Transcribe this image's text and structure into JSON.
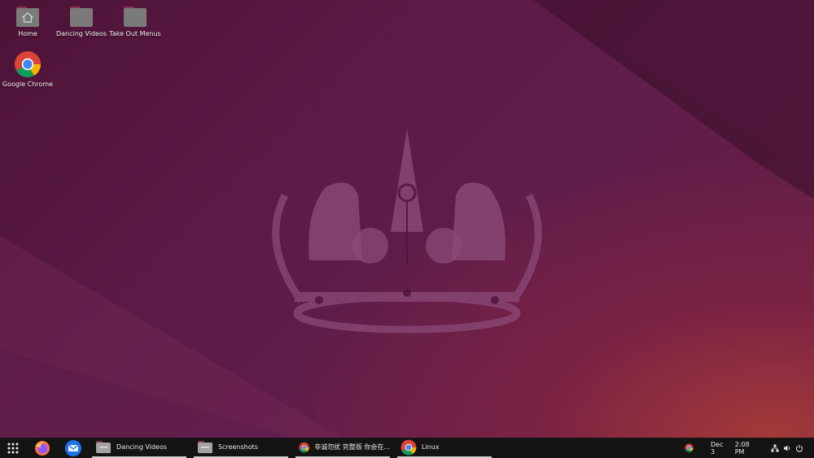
{
  "desktop_icons": [
    {
      "id": "home",
      "label": "Home",
      "icon": "home-folder-icon"
    },
    {
      "id": "dancing",
      "label": "Dancing Videos",
      "icon": "folder-icon"
    },
    {
      "id": "takeout",
      "label": "Take Out Menus",
      "icon": "folder-icon"
    },
    {
      "id": "chrome",
      "label": "Google Chrome",
      "icon": "chrome-icon"
    }
  ],
  "taskbar": {
    "launcher_icon": "app-grid-icon",
    "pinned": [
      {
        "name": "Firefox",
        "icon": "firefox-icon"
      },
      {
        "name": "Thunderbird",
        "icon": "thunderbird-icon"
      }
    ],
    "windows": [
      {
        "label": "Dancing Videos",
        "icon": "folder-icon"
      },
      {
        "label": "Screenshots",
        "icon": "folder-icon"
      },
      {
        "label": "非诚勿扰 完整版 你会在...",
        "icon": "chrome-icon"
      },
      {
        "label": "Linux",
        "icon": "chrome-icon"
      }
    ],
    "tray": {
      "date": "Dec 3",
      "time": "2:08 PM",
      "icons": [
        "chrome-tray-icon",
        "network-icon",
        "volume-icon",
        "power-icon"
      ]
    }
  },
  "colors": {
    "wallpaper_base": "#5a1b46",
    "wallpaper_accent": "#a33a38",
    "taskbar_bg": "#141414",
    "folder_body": "#7a7a7a",
    "folder_tab": "#8a2f4c"
  }
}
